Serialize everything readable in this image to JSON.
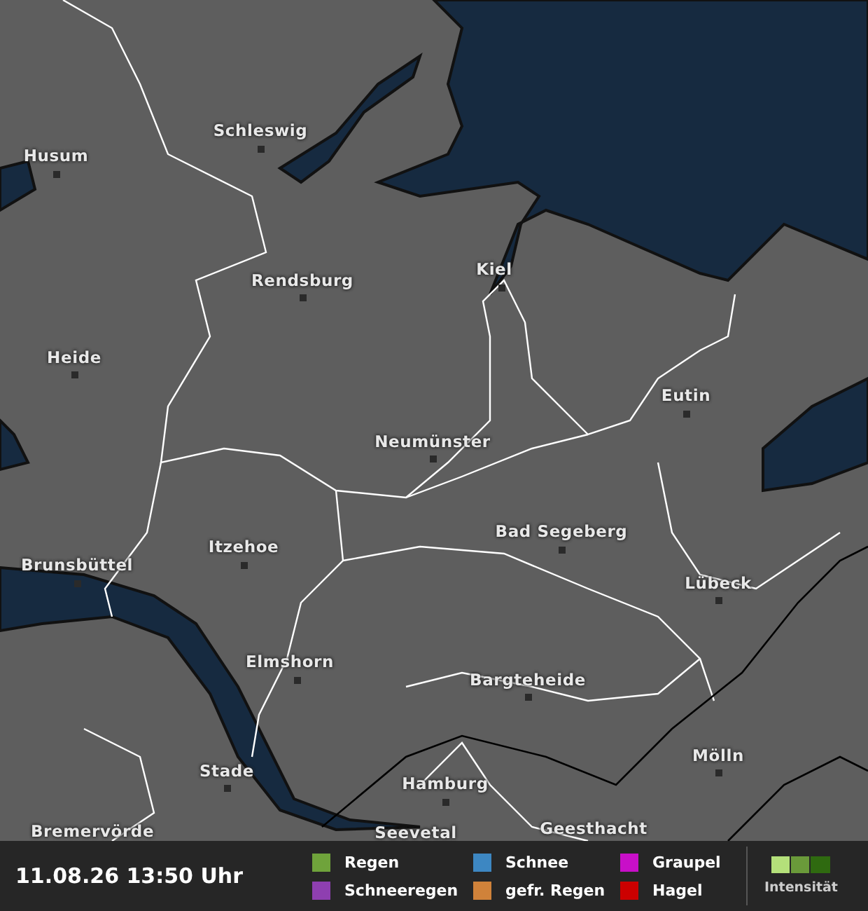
{
  "map": {
    "cities": [
      {
        "name": "Husum"
      },
      {
        "name": "Schleswig"
      },
      {
        "name": "Rendsburg"
      },
      {
        "name": "Kiel"
      },
      {
        "name": "Heide"
      },
      {
        "name": "Eutin"
      },
      {
        "name": "Neumünster"
      },
      {
        "name": "Bad Segeberg"
      },
      {
        "name": "Brunsbüttel"
      },
      {
        "name": "Itzehoe"
      },
      {
        "name": "Lübeck"
      },
      {
        "name": "Elmshorn"
      },
      {
        "name": "Bargteheide"
      },
      {
        "name": "Stade"
      },
      {
        "name": "Hamburg"
      },
      {
        "name": "Mölln"
      },
      {
        "name": "Bremervörde"
      },
      {
        "name": "Seevetal"
      },
      {
        "name": "Geesthacht"
      }
    ]
  },
  "legend_bar": {
    "timestamp": "11.08.26 13:50 Uhr",
    "precipitation_types": [
      {
        "label": "Regen",
        "color": "#6fa33b"
      },
      {
        "label": "Schneeregen",
        "color": "#8e3fb0"
      },
      {
        "label": "Schnee",
        "color": "#3d87c2"
      },
      {
        "label": "gefr. Regen",
        "color": "#d0823a"
      },
      {
        "label": "Graupel",
        "color": "#c80fc8"
      },
      {
        "label": "Hagel",
        "color": "#cc0000"
      }
    ],
    "intensity_label": "Intensität"
  }
}
